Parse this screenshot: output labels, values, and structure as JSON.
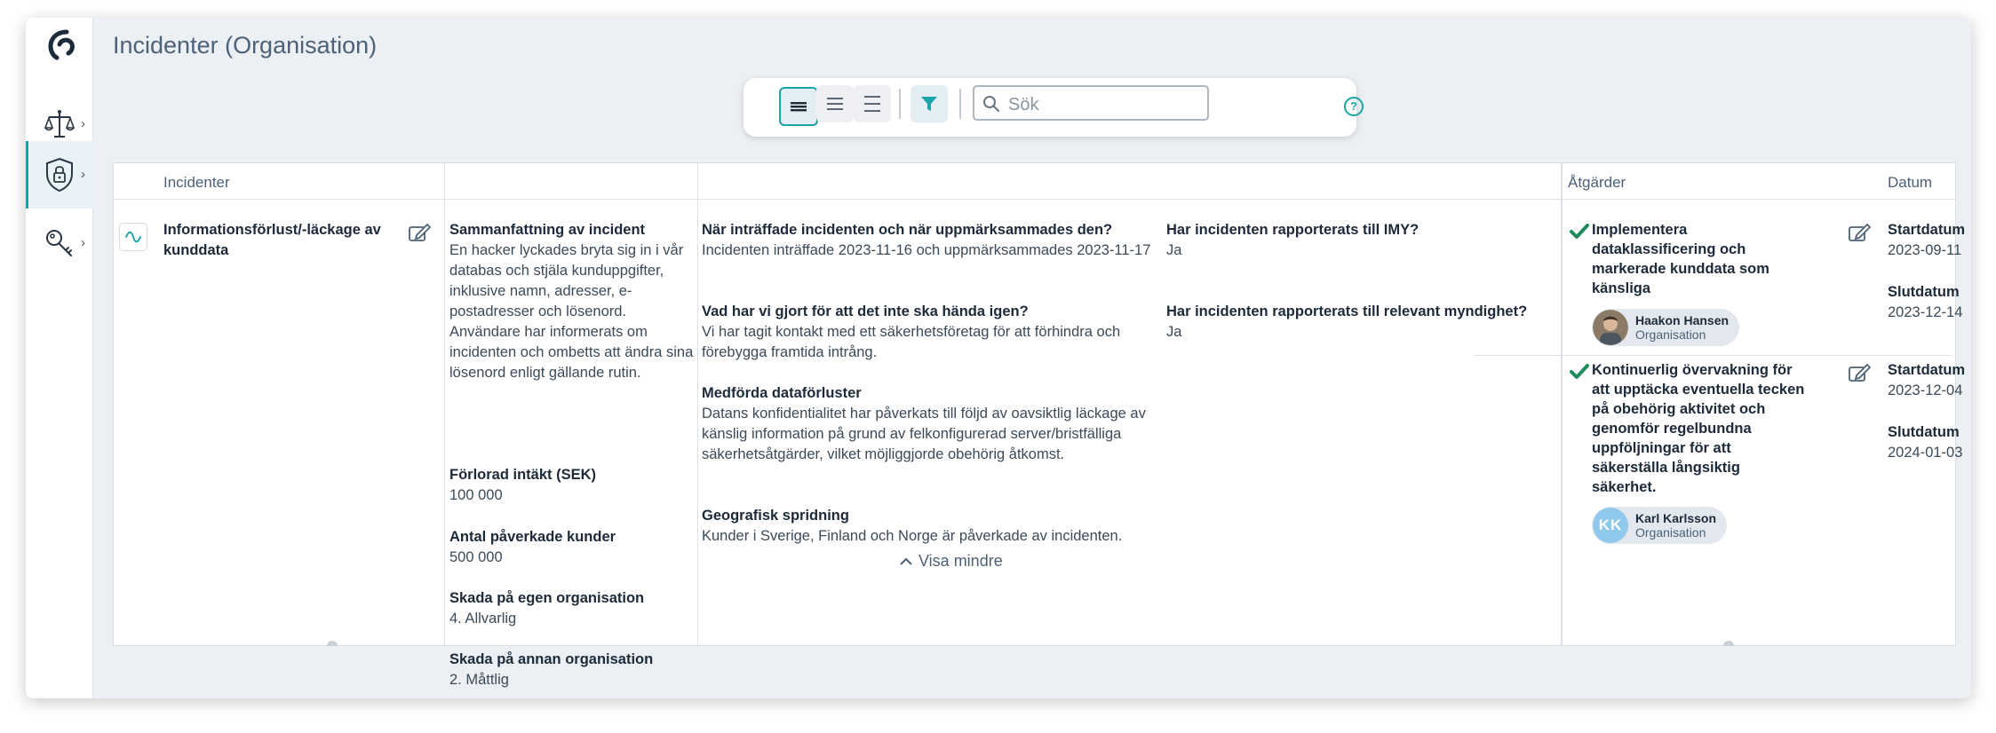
{
  "app": {
    "title": "Incidenter (Organisation)"
  },
  "rail": {
    "items": [
      {
        "name": "scales-icon"
      },
      {
        "name": "shield-lock-icon"
      },
      {
        "name": "key-icon"
      }
    ]
  },
  "toolbar": {
    "search_placeholder": "Sök",
    "help_glyph": "?"
  },
  "table": {
    "headers": {
      "incidents": "Incidenter",
      "actions": "Åtgärder",
      "date": "Datum"
    },
    "incident": {
      "name": "Informationsförlust/-läckage av kunddata",
      "summary_label": "Sammanfattning av incident",
      "summary_value": "En hacker lyckades bryta sig in i vår databas och stjäla kunduppgifter, inklusive namn, adresser, e-postadresser och lösenord. Användare har informerats om incidenten och ombetts att ändra sina lösenord enligt gällande rutin.",
      "lost_income_label": "Förlorad intäkt (SEK)",
      "lost_income_value": "100 000",
      "affected_customers_label": "Antal påverkade kunder",
      "affected_customers_value": "500 000",
      "damage_own_label": "Skada på egen organisation",
      "damage_own_value": "4. Allvarlig",
      "damage_other_label": "Skada på annan organisation",
      "damage_other_value": "2. Måttlig",
      "when_label": "När inträffade incidenten och när uppmärksammades den?",
      "when_value": "Incidenten inträffade 2023-11-16 och uppmärksammades 2023-11-17",
      "prevent_label": "Vad har vi gjort för att det inte ska hända igen?",
      "prevent_value": "Vi har tagit kontakt med ett säkerhetsföretag för att förhindra och förebygga framtida intrång.",
      "dataloss_label": "Medförda dataförluster",
      "dataloss_value": "Datans konfidentialitet har påverkats till följd av oavsiktlig läckage av känslig information på grund av felkonfigurerad server/bristfälliga säkerhetsåtgärder, vilket möjliggjorde obehörig åtkomst.",
      "geo_label": "Geografisk spridning",
      "geo_value": "Kunder i Sverige, Finland och Norge är påverkade av incidenten.",
      "imy_label": "Har incidenten rapporterats till IMY?",
      "imy_value": "Ja",
      "authority_label": "Har incidenten rapporterats till relevant myndighet?",
      "authority_value": "Ja",
      "show_less": "Visa mindre"
    },
    "actions": [
      {
        "title": "Implementera dataklassificering och markerade kunddata som känsliga",
        "person_name": "Haakon Hansen",
        "person_org": "Organisation",
        "start_label": "Startdatum",
        "start_value": "2023-09-11",
        "end_label": "Slutdatum",
        "end_value": "2023-12-14"
      },
      {
        "title": "Kontinuerlig övervakning för att upptäcka eventuella tecken på obehörig aktivitet och genomför regelbundna uppföljningar för att säkerställa långsiktig säkerhet.",
        "person_initials": "KK",
        "person_name": "Karl Karlsson",
        "person_org": "Organisation",
        "start_label": "Startdatum",
        "start_value": "2023-12-04",
        "end_label": "Slutdatum",
        "end_value": "2024-01-03"
      }
    ]
  },
  "colors": {
    "accent": "#17a5a8",
    "check": "#1f8a5b",
    "avatar_kk": "#8fc9ec"
  }
}
